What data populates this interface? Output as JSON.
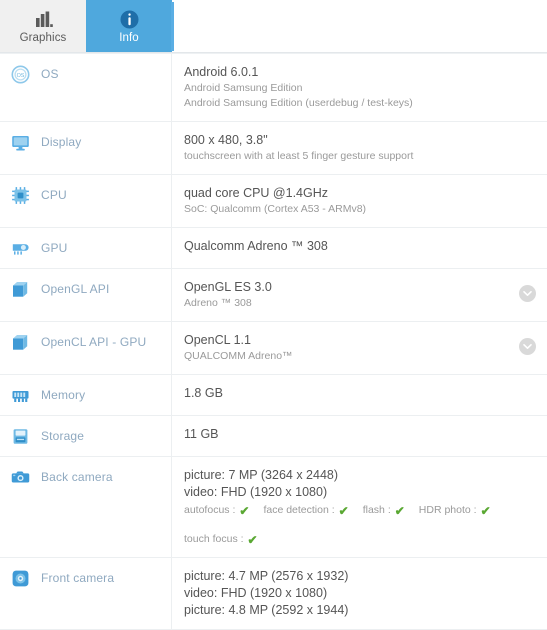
{
  "tabs": [
    {
      "label": "Graphics",
      "icon": "bar-chart-icon",
      "active": false
    },
    {
      "label": "Info",
      "icon": "info-icon",
      "active": true
    }
  ],
  "colors": {
    "tab_active_bg": "#4fa8dd",
    "tab_inactive_bg": "#f0f0f0",
    "label_text": "#8fa9c0",
    "icon_blue": "#5aaee4",
    "check_green": "#5aa833",
    "expander_gray": "#d9d9d9"
  },
  "rows": [
    {
      "label": "OS",
      "icon": "os-badge-icon",
      "main": "Android 6.0.1",
      "sub": [
        "Android Samsung Edition",
        "Android Samsung Edition (userdebug / test-keys)"
      ],
      "expandable": false
    },
    {
      "label": "Display",
      "icon": "monitor-icon",
      "main": "800 x 480, 3.8\"",
      "sub": [
        "touchscreen with at least 5 finger gesture support"
      ],
      "expandable": false
    },
    {
      "label": "CPU",
      "icon": "cpu-chip-icon",
      "main": "quad core CPU @1.4GHz",
      "sub": [
        "SoC: Qualcomm (Cortex A53 - ARMv8)"
      ],
      "expandable": false
    },
    {
      "label": "GPU",
      "icon": "gpu-icon",
      "main": "Qualcomm Adreno ™ 308",
      "sub": [],
      "expandable": false
    },
    {
      "label": "OpenGL API",
      "icon": "cube-icon",
      "main": "OpenGL ES 3.0",
      "sub": [
        "Adreno ™ 308"
      ],
      "expandable": true
    },
    {
      "label": "OpenCL API - GPU",
      "icon": "cube-icon",
      "main": "OpenCL 1.1",
      "sub": [
        "QUALCOMM Adreno™"
      ],
      "expandable": true
    },
    {
      "label": "Memory",
      "icon": "memory-chip-icon",
      "main": "1.8 GB",
      "sub": [],
      "expandable": false
    },
    {
      "label": "Storage",
      "icon": "storage-drive-icon",
      "main": "11 GB",
      "sub": [],
      "expandable": false
    },
    {
      "label": "Back camera",
      "icon": "back-camera-icon",
      "main": "picture: 7 MP (3264 x 2448)",
      "sub": [
        "video: FHD (1920 x 1080)"
      ],
      "features": [
        "autofocus :",
        "face detection :",
        "flash :",
        "HDR photo :"
      ],
      "features2": [
        "touch focus :"
      ],
      "expandable": false
    },
    {
      "label": "Front camera",
      "icon": "front-camera-icon",
      "main": "picture: 4.7 MP (2576 x 1932)",
      "sub": [
        "video: FHD (1920 x 1080)",
        "picture: 4.8 MP (2592 x 1944)"
      ],
      "expandable": false
    }
  ]
}
